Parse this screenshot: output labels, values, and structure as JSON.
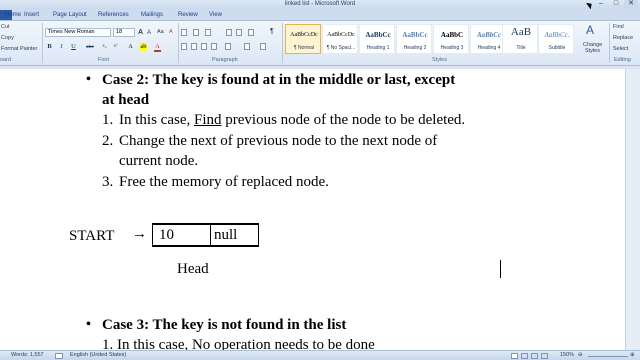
{
  "window": {
    "title": "linked list - Microsoft Word"
  },
  "tabs": {
    "home": "Home",
    "insert": "Insert",
    "page_layout": "Page Layout",
    "references": "References",
    "mailings": "Mailings",
    "review": "Review",
    "view": "View"
  },
  "clipboard": {
    "cut": "Cut",
    "copy": "Copy",
    "format_painter": "Format Painter",
    "label": "oard"
  },
  "font": {
    "name": "Times New Roman",
    "size": "18",
    "bold": "B",
    "italic": "I",
    "underline": "U",
    "strike": "abe",
    "grow": "A",
    "shrink": "A",
    "aa": "Aa",
    "clear": "A",
    "color": "A",
    "label": "Font"
  },
  "paragraph": {
    "pilcrow": "¶",
    "label": "Paragraph"
  },
  "styles": {
    "items": [
      {
        "sample": "AaBbCcDc",
        "name": "¶ Normal"
      },
      {
        "sample": "AaBbCcDc",
        "name": "¶ No Spaci..."
      },
      {
        "sample": "AaBbCc",
        "name": "Heading 1"
      },
      {
        "sample": "AaBbCc",
        "name": "Heading 2"
      },
      {
        "sample": "AaBbC",
        "name": "Heading 3"
      },
      {
        "sample": "AaBbCc",
        "name": "Heading 4"
      },
      {
        "sample": "AaB",
        "name": "Title"
      },
      {
        "sample": "AaBbCc.",
        "name": "Subtitle"
      }
    ],
    "change_styles_line1": "Change",
    "change_styles_line2": "Styles",
    "label": "Styles"
  },
  "editing": {
    "find": "Find",
    "replace": "Replace",
    "select": "Select",
    "label": "Editing"
  },
  "document": {
    "case2_line1": "Case 2: The key is found at in the middle or last, except",
    "case2_line2": "at head",
    "step1_num": "1.",
    "step1_pre": "In this case, ",
    "step1_link": "Find",
    "step1_post": " previous node of the node to be deleted.",
    "step2_num": "2.",
    "step2_line1": "Change the next of previous node to the next node of",
    "step2_line2": "current node.",
    "step3_num": "3.",
    "step3_text": "Free the memory of replaced node.",
    "start_label": "START",
    "arrow": "→",
    "node_value": "10",
    "node_next": "null",
    "head_label": "Head",
    "case3_line": "Case 3: The key is not found in the list",
    "case3_step1": "1. In this case, No operation needs to be done"
  },
  "status": {
    "words": "Words: 1,557",
    "language": "English (United States)",
    "zoom": "150%"
  },
  "colors": {
    "ribbon": "#dce7f5",
    "file_tab": "#2a5aa6",
    "selected_style": "#fff3d1"
  }
}
